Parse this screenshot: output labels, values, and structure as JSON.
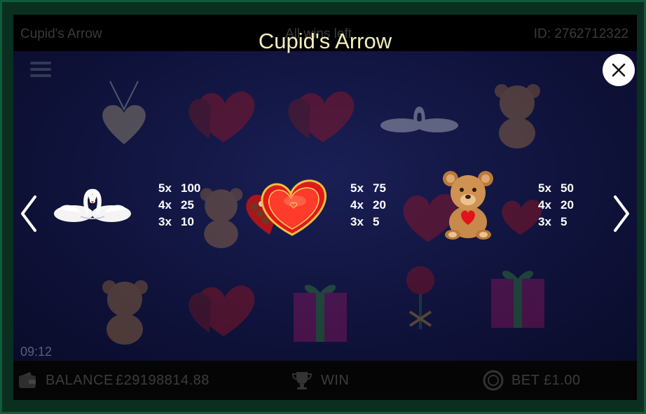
{
  "header": {
    "game_title": "Cupid's Arrow",
    "center_text": "All wins left",
    "game_id": "ID: 2762712322"
  },
  "popup": {
    "title": "Cupid's Arrow"
  },
  "paytable": [
    {
      "symbol": "swans-icon",
      "payouts": [
        {
          "count": "5x",
          "value": "100"
        },
        {
          "count": "4x",
          "value": "25"
        },
        {
          "count": "3x",
          "value": "10"
        }
      ]
    },
    {
      "symbol": "chocolate-heart-box-icon",
      "payouts": [
        {
          "count": "5x",
          "value": "75"
        },
        {
          "count": "4x",
          "value": "20"
        },
        {
          "count": "3x",
          "value": "5"
        }
      ]
    },
    {
      "symbol": "teddy-bear-icon",
      "payouts": [
        {
          "count": "5x",
          "value": "50"
        },
        {
          "count": "4x",
          "value": "20"
        },
        {
          "count": "3x",
          "value": "5"
        }
      ]
    }
  ],
  "status": {
    "clock": "09:12",
    "balance_label": "BALANCE",
    "balance_value": "£29198814.88",
    "win_label": "WIN",
    "bet_label": "BET",
    "bet_value": "£1.00"
  },
  "colors": {
    "title": "#f3eebd",
    "frame": "#0f5b3a",
    "reel_bg": "#131744"
  }
}
